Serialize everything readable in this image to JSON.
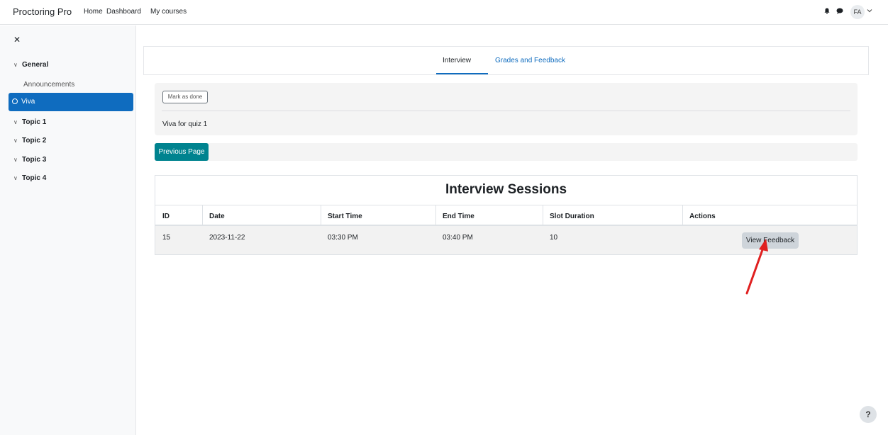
{
  "navbar": {
    "brand": "Proctoring Pro",
    "links": [
      "Home",
      "Dashboard",
      "My courses"
    ],
    "avatar_initials": "FA"
  },
  "drawer": {
    "sections": [
      {
        "label": "General"
      },
      {
        "label": "Topic 1"
      },
      {
        "label": "Topic 2"
      },
      {
        "label": "Topic 3"
      },
      {
        "label": "Topic 4"
      }
    ],
    "activity": "Announcements",
    "active_item": "Viva"
  },
  "tabs": {
    "interview": "Interview",
    "grades": "Grades and Feedback"
  },
  "completion": {
    "button_label": "Mark as done",
    "description": "Viva for quiz 1"
  },
  "previous_button": "Previous Page",
  "sessions": {
    "title": "Interview Sessions",
    "headers": [
      "ID",
      "Date",
      "Start Time",
      "End Time",
      "Slot Duration",
      "Actions"
    ],
    "rows": [
      {
        "id": "15",
        "date": "2023-11-22",
        "start": "03:30 PM",
        "end": "03:40 PM",
        "duration": "10",
        "action": "View Feedback"
      }
    ]
  },
  "help": "?",
  "colors": {
    "accent": "#0f6cbf",
    "teal": "#00838f",
    "arrow": "#e02020"
  }
}
